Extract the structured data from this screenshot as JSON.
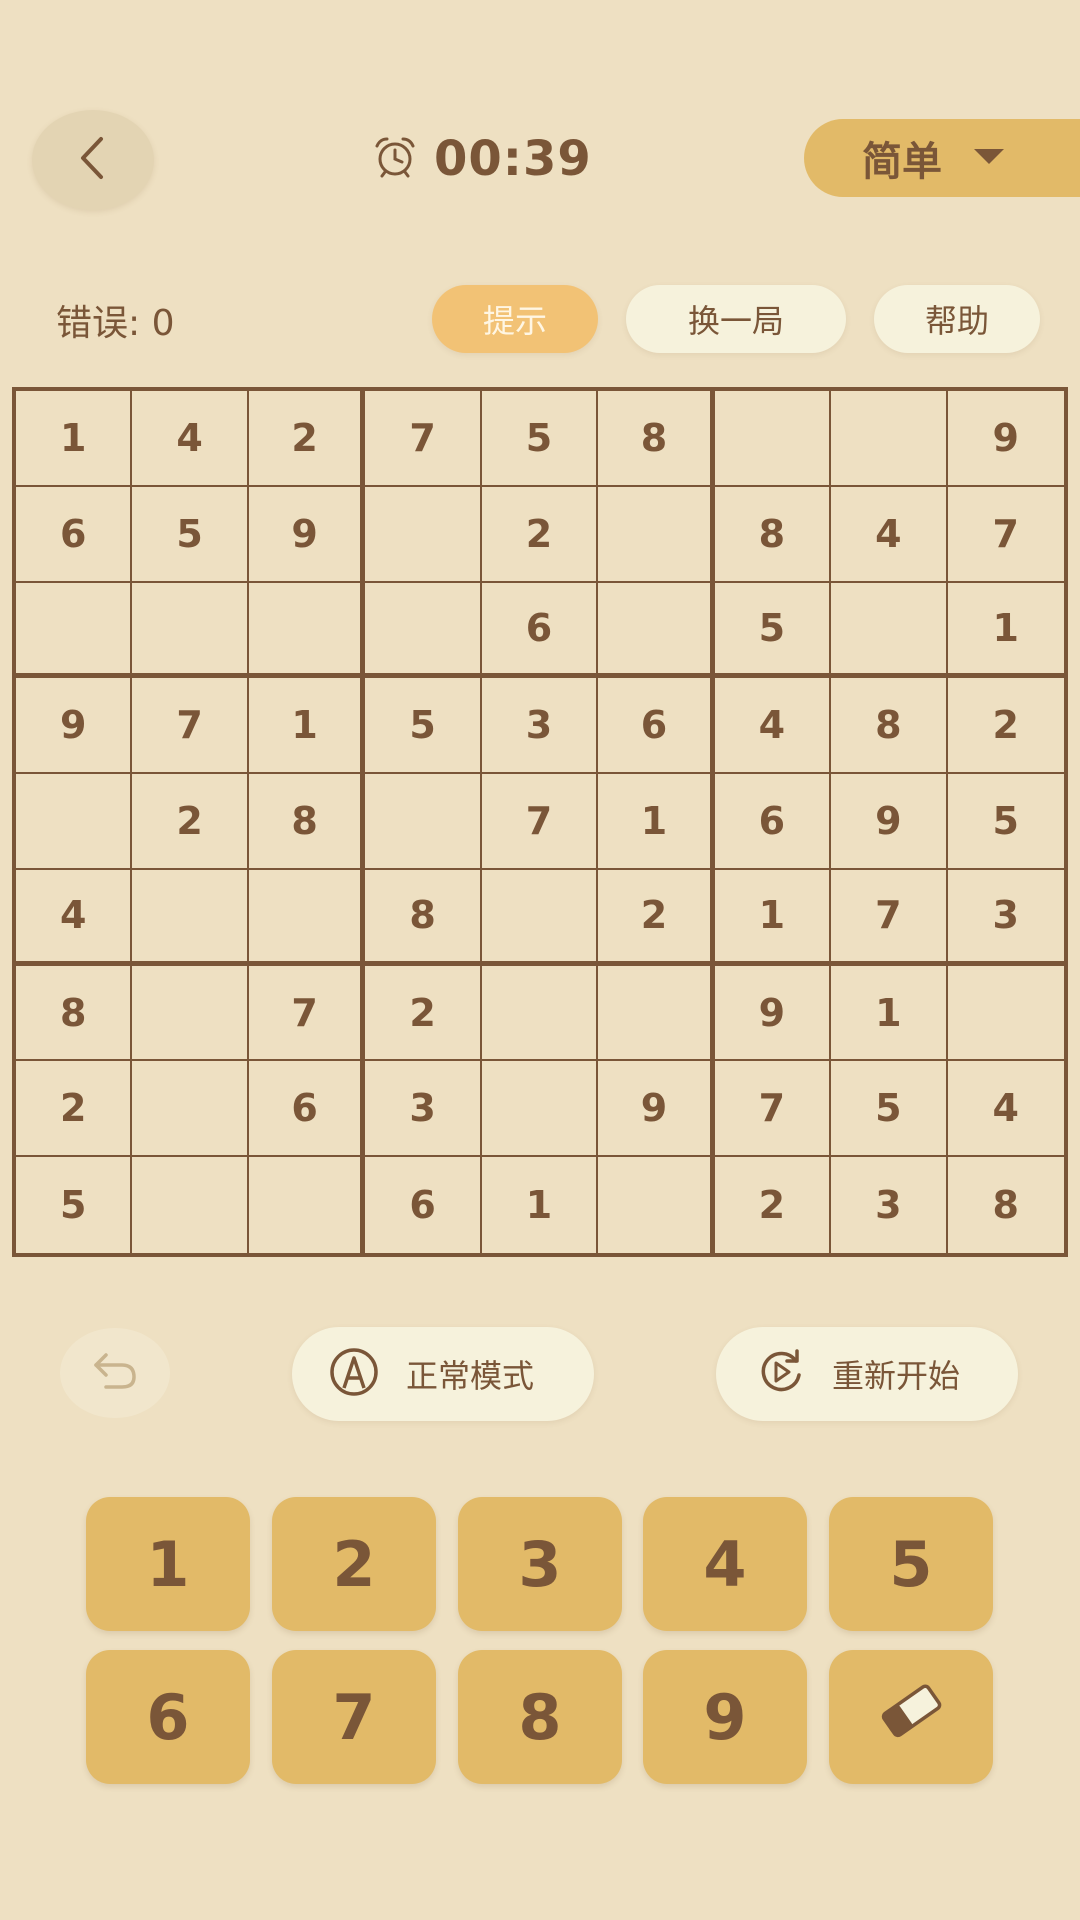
{
  "header": {
    "back_icon": "chevron-left-icon",
    "timer_icon": "alarm-clock-icon",
    "timer": "00:39",
    "difficulty": "简单",
    "difficulty_icon": "caret-down-icon"
  },
  "status": {
    "errors": "错误: 0"
  },
  "actions": {
    "hint": "提示",
    "new_game": "换一局",
    "help": "帮助"
  },
  "board": {
    "rows": [
      [
        "1",
        "4",
        "2",
        "7",
        "5",
        "8",
        "",
        "",
        "9"
      ],
      [
        "6",
        "5",
        "9",
        "",
        "2",
        "",
        "8",
        "4",
        "7"
      ],
      [
        "",
        "",
        "",
        "",
        "6",
        "",
        "5",
        "",
        "1"
      ],
      [
        "9",
        "7",
        "1",
        "5",
        "3",
        "6",
        "4",
        "8",
        "2"
      ],
      [
        "",
        "2",
        "8",
        "",
        "7",
        "1",
        "6",
        "9",
        "5"
      ],
      [
        "4",
        "",
        "",
        "8",
        "",
        "2",
        "1",
        "7",
        "3"
      ],
      [
        "8",
        "",
        "7",
        "2",
        "",
        "",
        "9",
        "1",
        ""
      ],
      [
        "2",
        "",
        "6",
        "3",
        "",
        "9",
        "7",
        "5",
        "4"
      ],
      [
        "5",
        "",
        "",
        "6",
        "1",
        "",
        "2",
        "3",
        "8"
      ]
    ]
  },
  "tools": {
    "undo_icon": "undo-icon",
    "mode_icon": "pencil-circle-icon",
    "mode": "正常模式",
    "restart_icon": "restart-icon",
    "restart": "重新开始"
  },
  "keypad": {
    "keys": [
      "1",
      "2",
      "3",
      "4",
      "5",
      "6",
      "7",
      "8",
      "9"
    ],
    "erase_icon": "eraser-icon"
  },
  "colors": {
    "background": "#EEE0C2",
    "accent": "#E2BA68",
    "hint": "#F2C275",
    "pill": "#F6F2DC",
    "text": "#7A5638"
  }
}
